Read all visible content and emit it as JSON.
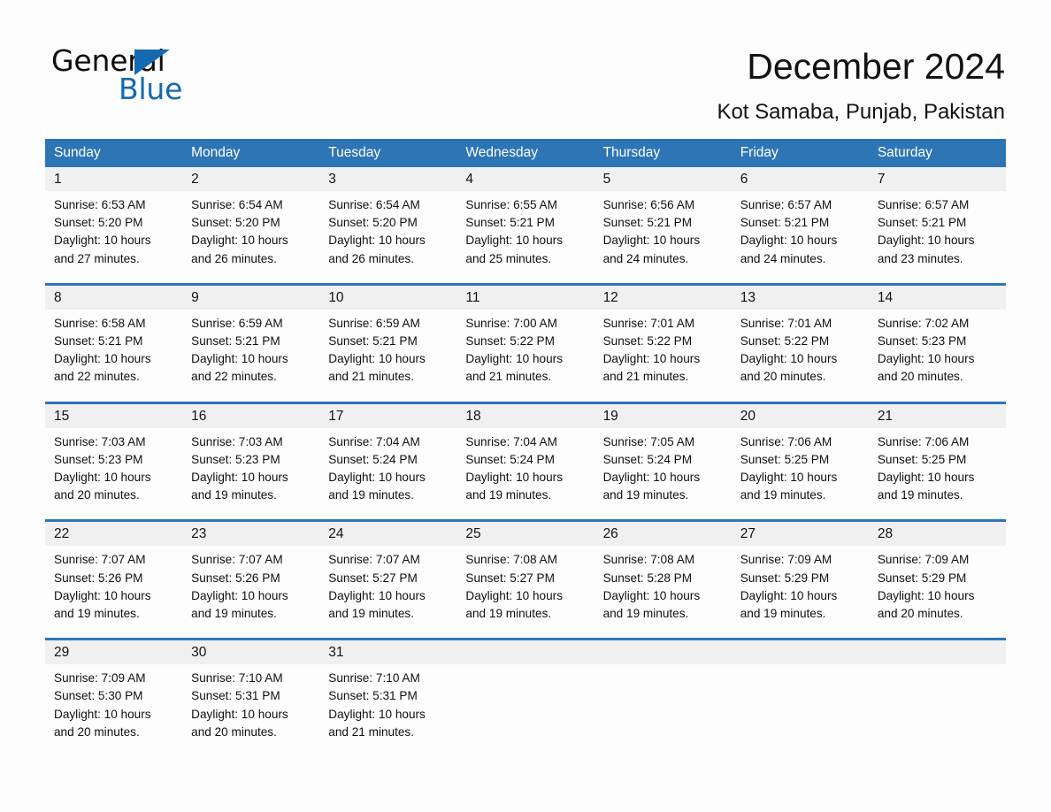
{
  "brand": {
    "name_part1": "General",
    "name_part2": "Blue",
    "accent_color": "#1569b0"
  },
  "header": {
    "title": "December 2024",
    "location": "Kot Samaba, Punjab, Pakistan",
    "header_band_color": "#2e75b6",
    "day_band_color": "#f0f0f0"
  },
  "weekdays": [
    "Sunday",
    "Monday",
    "Tuesday",
    "Wednesday",
    "Thursday",
    "Friday",
    "Saturday"
  ],
  "weeks": [
    {
      "days": [
        {
          "num": "1",
          "sunrise": "Sunrise: 6:53 AM",
          "sunset": "Sunset: 5:20 PM",
          "daylight_l1": "Daylight: 10 hours",
          "daylight_l2": "and 27 minutes."
        },
        {
          "num": "2",
          "sunrise": "Sunrise: 6:54 AM",
          "sunset": "Sunset: 5:20 PM",
          "daylight_l1": "Daylight: 10 hours",
          "daylight_l2": "and 26 minutes."
        },
        {
          "num": "3",
          "sunrise": "Sunrise: 6:54 AM",
          "sunset": "Sunset: 5:20 PM",
          "daylight_l1": "Daylight: 10 hours",
          "daylight_l2": "and 26 minutes."
        },
        {
          "num": "4",
          "sunrise": "Sunrise: 6:55 AM",
          "sunset": "Sunset: 5:21 PM",
          "daylight_l1": "Daylight: 10 hours",
          "daylight_l2": "and 25 minutes."
        },
        {
          "num": "5",
          "sunrise": "Sunrise: 6:56 AM",
          "sunset": "Sunset: 5:21 PM",
          "daylight_l1": "Daylight: 10 hours",
          "daylight_l2": "and 24 minutes."
        },
        {
          "num": "6",
          "sunrise": "Sunrise: 6:57 AM",
          "sunset": "Sunset: 5:21 PM",
          "daylight_l1": "Daylight: 10 hours",
          "daylight_l2": "and 24 minutes."
        },
        {
          "num": "7",
          "sunrise": "Sunrise: 6:57 AM",
          "sunset": "Sunset: 5:21 PM",
          "daylight_l1": "Daylight: 10 hours",
          "daylight_l2": "and 23 minutes."
        }
      ]
    },
    {
      "days": [
        {
          "num": "8",
          "sunrise": "Sunrise: 6:58 AM",
          "sunset": "Sunset: 5:21 PM",
          "daylight_l1": "Daylight: 10 hours",
          "daylight_l2": "and 22 minutes."
        },
        {
          "num": "9",
          "sunrise": "Sunrise: 6:59 AM",
          "sunset": "Sunset: 5:21 PM",
          "daylight_l1": "Daylight: 10 hours",
          "daylight_l2": "and 22 minutes."
        },
        {
          "num": "10",
          "sunrise": "Sunrise: 6:59 AM",
          "sunset": "Sunset: 5:21 PM",
          "daylight_l1": "Daylight: 10 hours",
          "daylight_l2": "and 21 minutes."
        },
        {
          "num": "11",
          "sunrise": "Sunrise: 7:00 AM",
          "sunset": "Sunset: 5:22 PM",
          "daylight_l1": "Daylight: 10 hours",
          "daylight_l2": "and 21 minutes."
        },
        {
          "num": "12",
          "sunrise": "Sunrise: 7:01 AM",
          "sunset": "Sunset: 5:22 PM",
          "daylight_l1": "Daylight: 10 hours",
          "daylight_l2": "and 21 minutes."
        },
        {
          "num": "13",
          "sunrise": "Sunrise: 7:01 AM",
          "sunset": "Sunset: 5:22 PM",
          "daylight_l1": "Daylight: 10 hours",
          "daylight_l2": "and 20 minutes."
        },
        {
          "num": "14",
          "sunrise": "Sunrise: 7:02 AM",
          "sunset": "Sunset: 5:23 PM",
          "daylight_l1": "Daylight: 10 hours",
          "daylight_l2": "and 20 minutes."
        }
      ]
    },
    {
      "days": [
        {
          "num": "15",
          "sunrise": "Sunrise: 7:03 AM",
          "sunset": "Sunset: 5:23 PM",
          "daylight_l1": "Daylight: 10 hours",
          "daylight_l2": "and 20 minutes."
        },
        {
          "num": "16",
          "sunrise": "Sunrise: 7:03 AM",
          "sunset": "Sunset: 5:23 PM",
          "daylight_l1": "Daylight: 10 hours",
          "daylight_l2": "and 19 minutes."
        },
        {
          "num": "17",
          "sunrise": "Sunrise: 7:04 AM",
          "sunset": "Sunset: 5:24 PM",
          "daylight_l1": "Daylight: 10 hours",
          "daylight_l2": "and 19 minutes."
        },
        {
          "num": "18",
          "sunrise": "Sunrise: 7:04 AM",
          "sunset": "Sunset: 5:24 PM",
          "daylight_l1": "Daylight: 10 hours",
          "daylight_l2": "and 19 minutes."
        },
        {
          "num": "19",
          "sunrise": "Sunrise: 7:05 AM",
          "sunset": "Sunset: 5:24 PM",
          "daylight_l1": "Daylight: 10 hours",
          "daylight_l2": "and 19 minutes."
        },
        {
          "num": "20",
          "sunrise": "Sunrise: 7:06 AM",
          "sunset": "Sunset: 5:25 PM",
          "daylight_l1": "Daylight: 10 hours",
          "daylight_l2": "and 19 minutes."
        },
        {
          "num": "21",
          "sunrise": "Sunrise: 7:06 AM",
          "sunset": "Sunset: 5:25 PM",
          "daylight_l1": "Daylight: 10 hours",
          "daylight_l2": "and 19 minutes."
        }
      ]
    },
    {
      "days": [
        {
          "num": "22",
          "sunrise": "Sunrise: 7:07 AM",
          "sunset": "Sunset: 5:26 PM",
          "daylight_l1": "Daylight: 10 hours",
          "daylight_l2": "and 19 minutes."
        },
        {
          "num": "23",
          "sunrise": "Sunrise: 7:07 AM",
          "sunset": "Sunset: 5:26 PM",
          "daylight_l1": "Daylight: 10 hours",
          "daylight_l2": "and 19 minutes."
        },
        {
          "num": "24",
          "sunrise": "Sunrise: 7:07 AM",
          "sunset": "Sunset: 5:27 PM",
          "daylight_l1": "Daylight: 10 hours",
          "daylight_l2": "and 19 minutes."
        },
        {
          "num": "25",
          "sunrise": "Sunrise: 7:08 AM",
          "sunset": "Sunset: 5:27 PM",
          "daylight_l1": "Daylight: 10 hours",
          "daylight_l2": "and 19 minutes."
        },
        {
          "num": "26",
          "sunrise": "Sunrise: 7:08 AM",
          "sunset": "Sunset: 5:28 PM",
          "daylight_l1": "Daylight: 10 hours",
          "daylight_l2": "and 19 minutes."
        },
        {
          "num": "27",
          "sunrise": "Sunrise: 7:09 AM",
          "sunset": "Sunset: 5:29 PM",
          "daylight_l1": "Daylight: 10 hours",
          "daylight_l2": "and 19 minutes."
        },
        {
          "num": "28",
          "sunrise": "Sunrise: 7:09 AM",
          "sunset": "Sunset: 5:29 PM",
          "daylight_l1": "Daylight: 10 hours",
          "daylight_l2": "and 20 minutes."
        }
      ]
    },
    {
      "days": [
        {
          "num": "29",
          "sunrise": "Sunrise: 7:09 AM",
          "sunset": "Sunset: 5:30 PM",
          "daylight_l1": "Daylight: 10 hours",
          "daylight_l2": "and 20 minutes."
        },
        {
          "num": "30",
          "sunrise": "Sunrise: 7:10 AM",
          "sunset": "Sunset: 5:31 PM",
          "daylight_l1": "Daylight: 10 hours",
          "daylight_l2": "and 20 minutes."
        },
        {
          "num": "31",
          "sunrise": "Sunrise: 7:10 AM",
          "sunset": "Sunset: 5:31 PM",
          "daylight_l1": "Daylight: 10 hours",
          "daylight_l2": "and 21 minutes."
        },
        {
          "num": "",
          "sunrise": "",
          "sunset": "",
          "daylight_l1": "",
          "daylight_l2": "",
          "empty": true
        },
        {
          "num": "",
          "sunrise": "",
          "sunset": "",
          "daylight_l1": "",
          "daylight_l2": "",
          "empty": true
        },
        {
          "num": "",
          "sunrise": "",
          "sunset": "",
          "daylight_l1": "",
          "daylight_l2": "",
          "empty": true
        },
        {
          "num": "",
          "sunrise": "",
          "sunset": "",
          "daylight_l1": "",
          "daylight_l2": "",
          "empty": true
        }
      ]
    }
  ]
}
